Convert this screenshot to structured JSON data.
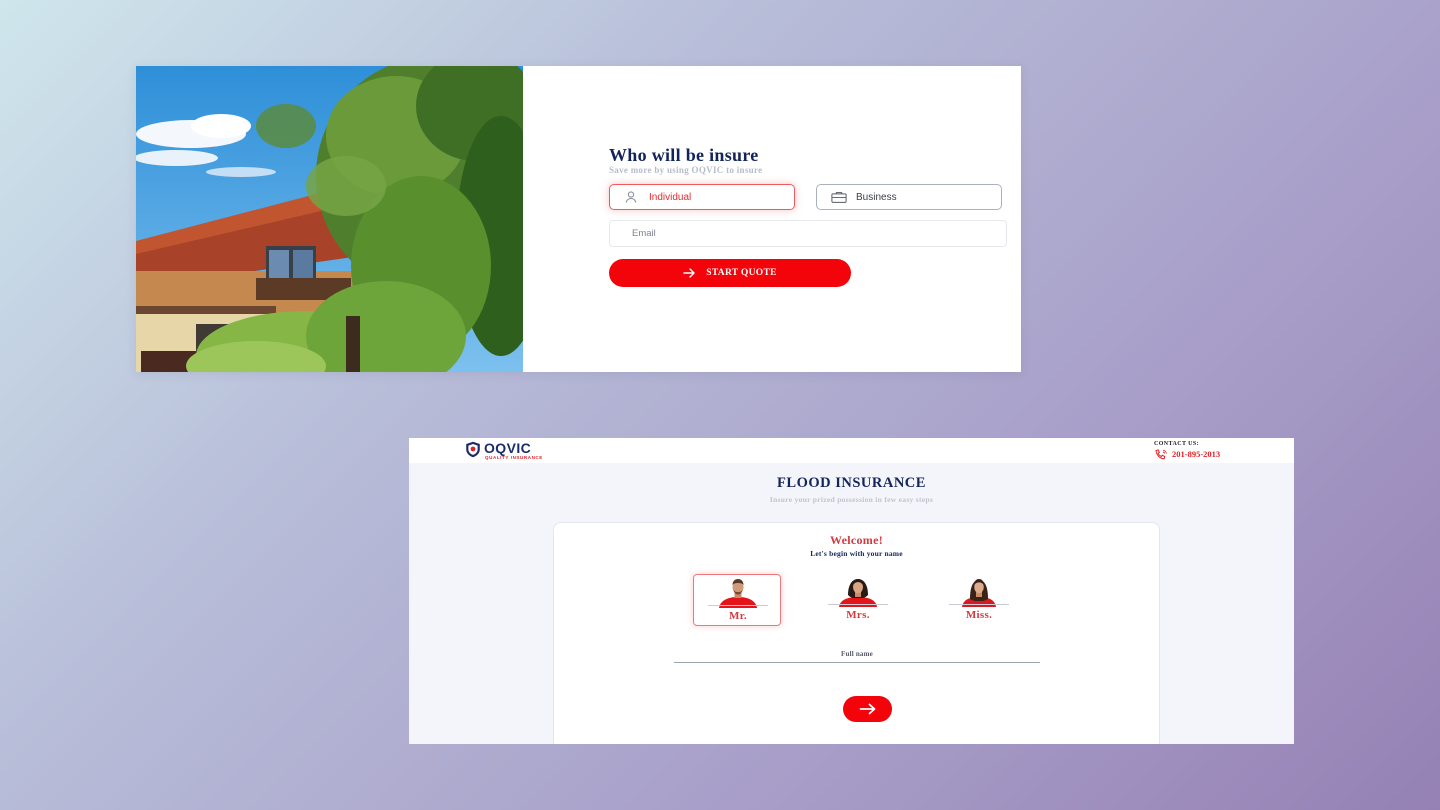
{
  "quote_card": {
    "hero_image": "house-in-trees-photo",
    "title": "Who will be insure",
    "subtitle": "Save more by using OQVIC to insure",
    "type_options": [
      {
        "label": "Individual",
        "icon": "user-icon",
        "selected": true
      },
      {
        "label": "Business",
        "icon": "briefcase-icon",
        "selected": false
      }
    ],
    "email": {
      "placeholder": "Email",
      "value": ""
    },
    "start_button": {
      "label": "START QUOTE",
      "icon": "arrow-right-icon"
    },
    "colors": {
      "accent": "#f2040a",
      "title": "#13245a"
    }
  },
  "flood_page": {
    "header": {
      "logo": {
        "name": "OQVIC",
        "tagline": "QUALITY INSURANCE"
      },
      "contact_label": "CONTACT US:",
      "phone": "201-895-2013",
      "phone_icon": "phone-icon"
    },
    "title": "FLOOD INSURANCE",
    "subtitle": "Insure your prized possession in few easy steps",
    "panel": {
      "welcome": "Welcome!",
      "prompt": "Let's begin with your name",
      "titles": [
        {
          "label": "Mr.",
          "selected": true
        },
        {
          "label": "Mrs.",
          "selected": false
        },
        {
          "label": "Miss.",
          "selected": false
        }
      ],
      "full_name": {
        "label": "Full name",
        "value": ""
      },
      "next_button_icon": "arrow-right-icon"
    },
    "colors": {
      "accent": "#e0232a",
      "title": "#13245a",
      "background": "#f4f4fb"
    }
  }
}
